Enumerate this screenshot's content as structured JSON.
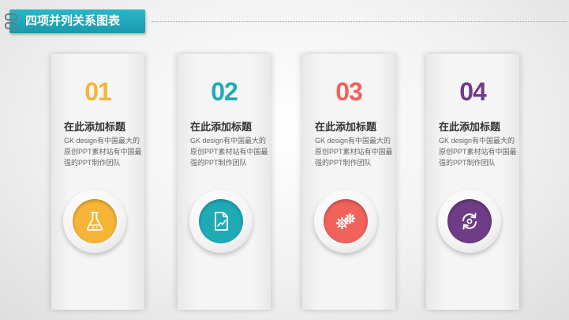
{
  "header": {
    "title": "四项并列关系图表"
  },
  "cards": [
    {
      "number": "01",
      "title": "在此添加标题",
      "desc": "GK design有中国最大的原创PPT素材站有中国最强的PPT制作团队",
      "color": "#f6b536",
      "icon": "flask-icon"
    },
    {
      "number": "02",
      "title": "在此添加标题",
      "desc": "GK design有中国最大的原创PPT素材站有中国最强的PPT制作团队",
      "color": "#1eabb6",
      "icon": "document-chart-icon"
    },
    {
      "number": "03",
      "title": "在此添加标题",
      "desc": "GK design有中国最大的原创PPT素材站有中国最强的PPT制作团队",
      "color": "#f0625a",
      "icon": "gears-icon"
    },
    {
      "number": "04",
      "title": "在此添加标题",
      "desc": "GK design有中国最大的原创PPT素材站有中国最强的PPT制作团队",
      "color": "#6f3d86",
      "icon": "refresh-cycle-icon"
    }
  ]
}
